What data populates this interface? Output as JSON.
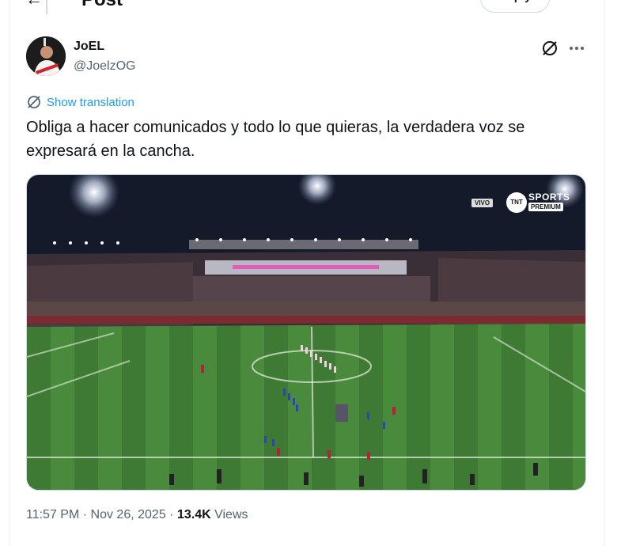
{
  "header": {
    "back_icon": "arrow-left-icon",
    "title": "Post",
    "reply_label": "Reply",
    "settings_icon": "adjust-icon"
  },
  "author": {
    "display_name": "JoEL",
    "handle": "@JoelzOG",
    "avatar": "profile-photo"
  },
  "actions": {
    "grok_icon": "grok-icon",
    "more_icon": "more-horizontal-icon"
  },
  "translation": {
    "label": "Show translation",
    "icon": "translate-icon",
    "color": "#1d9bf0"
  },
  "tweet": {
    "text": "Obliga a hacer comunicados y todo lo que quieras, la verdadera voz se expresará en la cancha."
  },
  "media": {
    "description_icon": "stadium-photo",
    "broadcast_live": "VIVO",
    "broadcast_logo": "TNT",
    "broadcast_sports": "SPORTS",
    "broadcast_premium": "PREMIUM"
  },
  "meta": {
    "time": "11:57 PM",
    "separator": "·",
    "date": "Nov 26, 2025",
    "views_count": "13.4K",
    "views_label": "Views"
  },
  "colors": {
    "text_primary": "#0f1419",
    "text_secondary": "#536471",
    "border": "#cfd9de",
    "accent": "#1d9bf0"
  }
}
